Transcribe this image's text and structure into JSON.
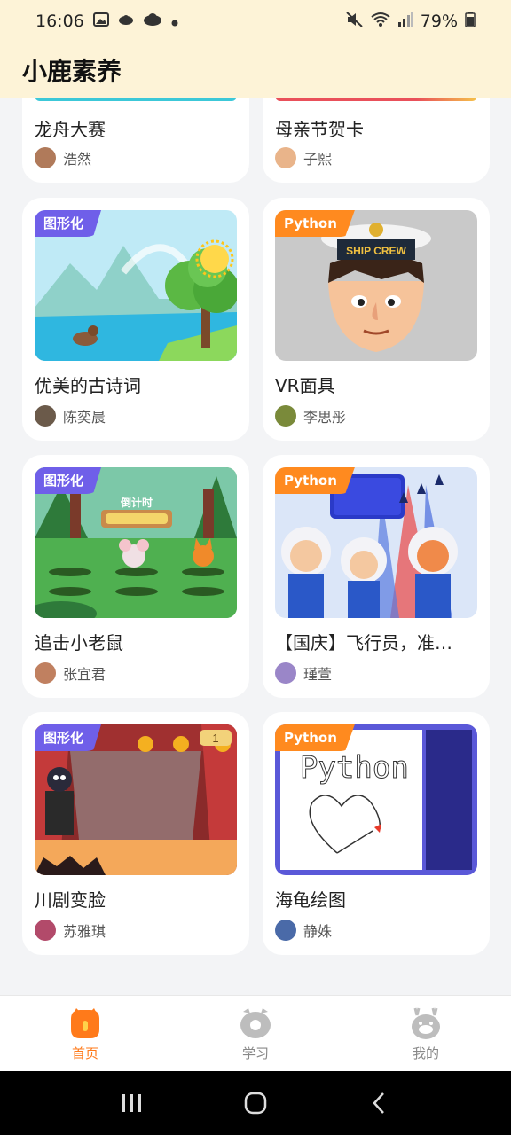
{
  "status": {
    "time": "16:06",
    "battery": "79%"
  },
  "header": {
    "title": "小鹿素养"
  },
  "top_row": [
    {
      "title": "龙舟大赛",
      "author": "浩然",
      "strip_color": "#3cc8d8",
      "avatar_color": "#b07a5a"
    },
    {
      "title": "母亲节贺卡",
      "author": "子熙",
      "strip_color": "#e9505a",
      "avatar_color": "#e9b48a"
    }
  ],
  "cards": [
    {
      "badge": "图形化",
      "badge_type": "graphic",
      "title": "优美的古诗词",
      "author": "陈奕晨",
      "avatar_color": "#6b5a4a",
      "thumb": "poem"
    },
    {
      "badge": "Python",
      "badge_type": "python",
      "title": "VR面具",
      "author": "李思彤",
      "avatar_color": "#7a8a3a",
      "thumb": "sailor"
    },
    {
      "badge": "图形化",
      "badge_type": "graphic",
      "title": "追击小老鼠",
      "author": "张宜君",
      "avatar_color": "#c08060",
      "thumb": "mouse",
      "thumb_text": "倒计时"
    },
    {
      "badge": "Python",
      "badge_type": "python",
      "title": "【国庆】飞行员，准…",
      "author": "瑾萱",
      "avatar_color": "#9a86c8",
      "thumb": "pilots"
    },
    {
      "badge": "图形化",
      "badge_type": "graphic",
      "title": "川剧变脸",
      "author": "苏雅琪",
      "avatar_color": "#b24a6a",
      "thumb": "opera",
      "thumb_text": "1"
    },
    {
      "badge": "Python",
      "badge_type": "python",
      "title": "海龟绘图",
      "author": "静姝",
      "avatar_color": "#4a6aa8",
      "thumb": "turtle",
      "thumb_text": "Python"
    }
  ],
  "nav": [
    {
      "label": "首页",
      "active": true,
      "icon": "home-icon"
    },
    {
      "label": "学习",
      "active": false,
      "icon": "study-icon"
    },
    {
      "label": "我的",
      "active": false,
      "icon": "profile-icon"
    }
  ],
  "colors": {
    "accent": "#ff7a1a",
    "header_bg": "#fdf3d7",
    "graphic_badge": "#6f5fe9",
    "python_badge": "#ff8a1f"
  }
}
